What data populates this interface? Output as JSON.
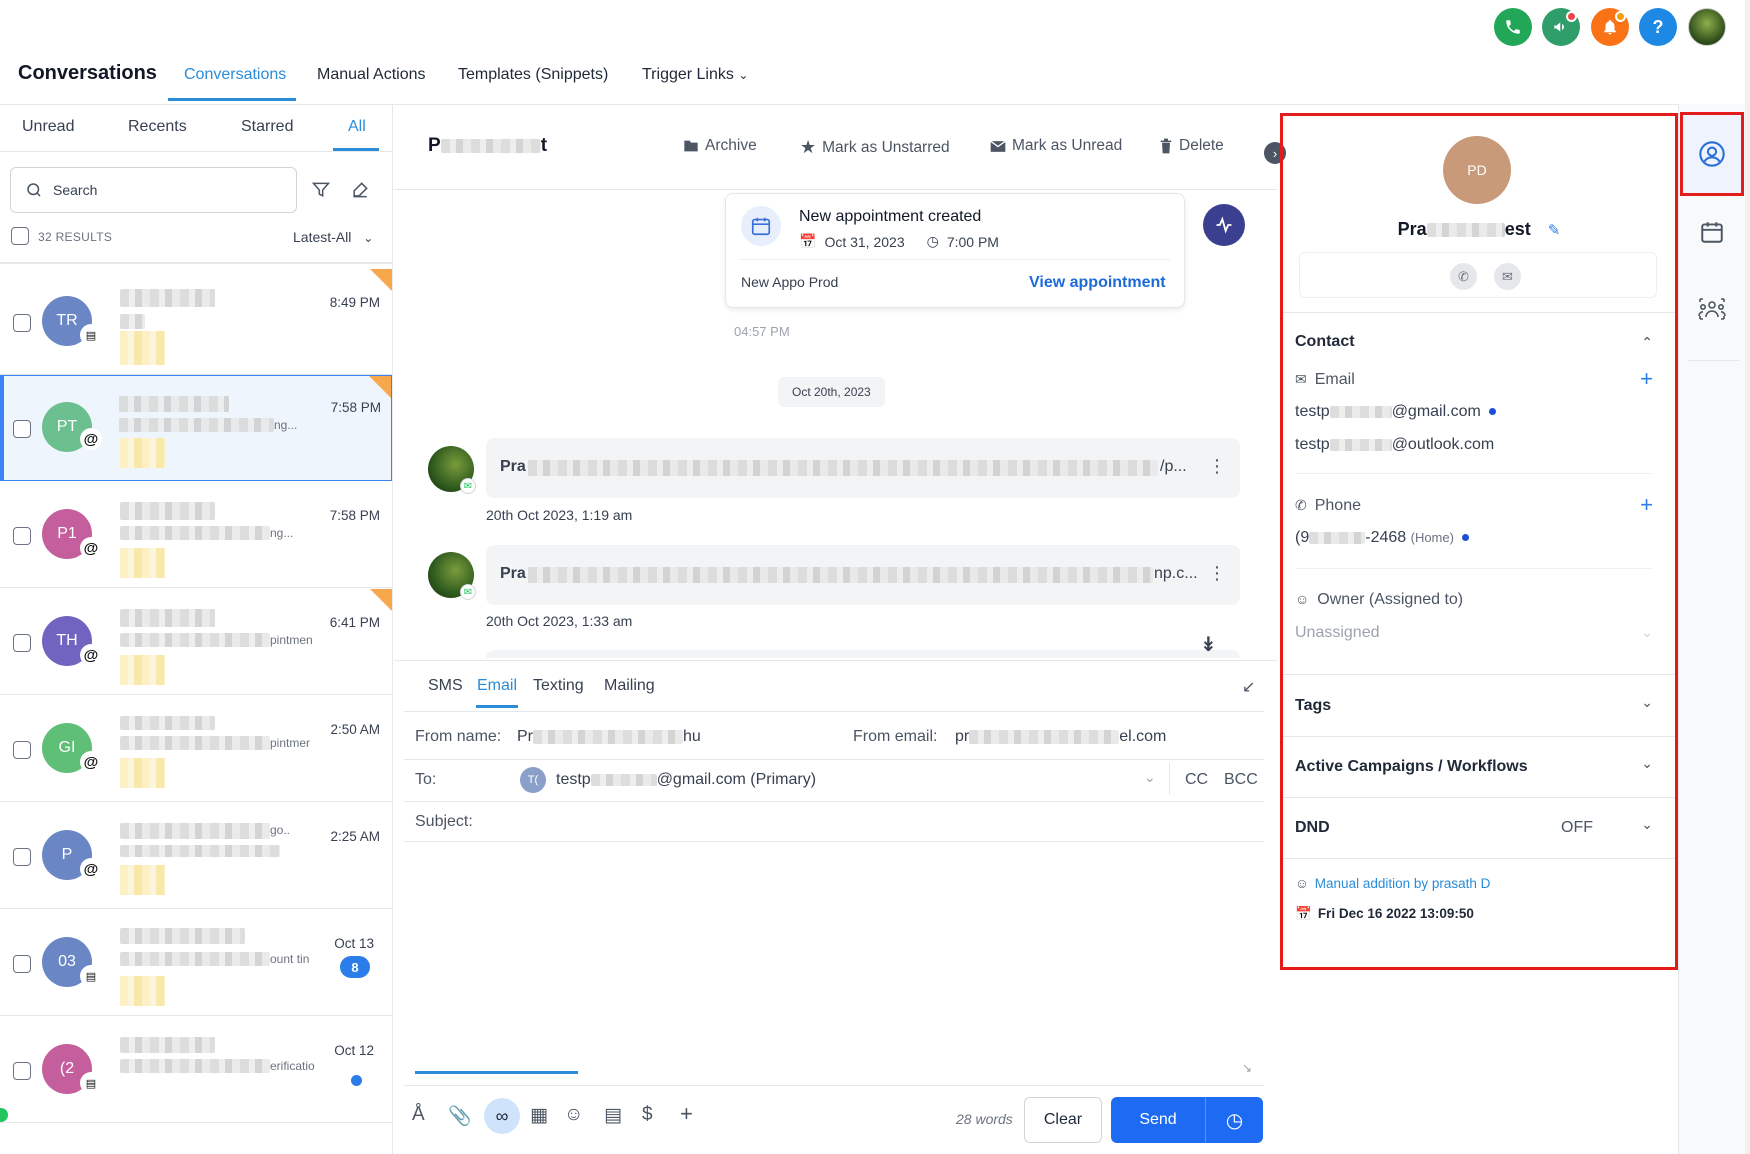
{
  "header": {
    "title": "Conversations",
    "nav": [
      "Conversations",
      "Manual Actions",
      "Templates (Snippets)",
      "Trigger Links"
    ],
    "help_glyph": "?"
  },
  "list": {
    "filters": [
      "Unread",
      "Recents",
      "Starred",
      "All"
    ],
    "search_placeholder": "Search",
    "results": "32 RESULTS",
    "sort": "Latest-All",
    "items": [
      {
        "initials": "TR",
        "time": "8:49 PM",
        "snippet": "",
        "badge": "chat",
        "starred": true,
        "color": "#6b86c4"
      },
      {
        "initials": "PT",
        "time": "7:58 PM",
        "snippet": "ng...",
        "badge": "@",
        "starred": true,
        "color": "#6cbf8e"
      },
      {
        "initials": "P1",
        "time": "7:58 PM",
        "snippet": "ng...",
        "badge": "@",
        "starred": false,
        "color": "#c45e9c"
      },
      {
        "initials": "TH",
        "time": "6:41 PM",
        "snippet": "pintmen",
        "badge": "@",
        "starred": true,
        "color": "#7164c0"
      },
      {
        "initials": "GI",
        "time": "2:50 AM",
        "snippet": "pintmer",
        "badge": "@",
        "starred": false,
        "color": "#5fbf77"
      },
      {
        "initials": "P",
        "time": "2:25 AM",
        "snippet": "go..",
        "badge": "@",
        "starred": false,
        "color": "#6b86c4"
      },
      {
        "initials": "03",
        "time": "Oct 13",
        "snippet": "ount tin",
        "badge": "chat",
        "unread": "8",
        "color": "#6b86c4"
      },
      {
        "initials": "(2",
        "time": "Oct 12",
        "snippet": "erificatio",
        "badge": "chat",
        "dot": true,
        "color": "#c45e9c"
      }
    ]
  },
  "conversation": {
    "name_start": "P",
    "name_end": "t",
    "actions": {
      "archive": "Archive",
      "unstar": "Mark as Unstarred",
      "unread": "Mark as Unread",
      "delete": "Delete"
    },
    "appointment": {
      "title": "New appointment created",
      "date": "Oct 31, 2023",
      "time": "7:00 PM",
      "calendar": "New Appo Prod",
      "link": "View appointment",
      "sent_at": "04:57 PM"
    },
    "date_divider": "Oct 20th, 2023",
    "messages": [
      {
        "preview_start": "Pra",
        "preview_end": "/p...",
        "meta": "20th Oct 2023, 1:19 am"
      },
      {
        "preview_start": "Pra",
        "preview_end": "np.c...",
        "meta": "20th Oct 2023, 1:33 am"
      }
    ]
  },
  "composer": {
    "tabs": [
      "SMS",
      "Email",
      "Texting",
      "Mailing"
    ],
    "from_name_label": "From name:",
    "from_name_value": "Pr",
    "from_name_suffix": "hu",
    "from_email_label": "From email:",
    "from_email_value": "pr",
    "from_email_suffix": "el.com",
    "to_label": "To:",
    "to_initial": "T(",
    "to_value_start": "testp",
    "to_value_end": "@gmail.com (Primary)",
    "cc": "CC",
    "bcc": "BCC",
    "subject_label": "Subject:",
    "word_count": "28 words",
    "clear": "Clear",
    "send": "Send"
  },
  "contact_panel": {
    "initials": "PD",
    "name_start": "Pra",
    "name_end": "est",
    "sections": {
      "contact": "Contact",
      "email_label": "Email",
      "emails": [
        {
          "start": "testp",
          "end": "@gmail.com"
        },
        {
          "start": "testp",
          "end": "@outlook.com"
        }
      ],
      "phone_label": "Phone",
      "phone_start": "(9",
      "phone_end": "-2468",
      "phone_type": "(Home)",
      "owner_label": "Owner (Assigned to)",
      "owner_value": "Unassigned",
      "tags": "Tags",
      "campaigns": "Active Campaigns / Workflows",
      "dnd": "DND",
      "dnd_value": "OFF"
    },
    "source": "Manual addition by prasath D",
    "created": "Fri Dec 16 2022 13:09:50"
  },
  "colors": {
    "accent": "#2b8cd7",
    "highlight": "#e31b1b",
    "send": "#1d6bf3"
  }
}
